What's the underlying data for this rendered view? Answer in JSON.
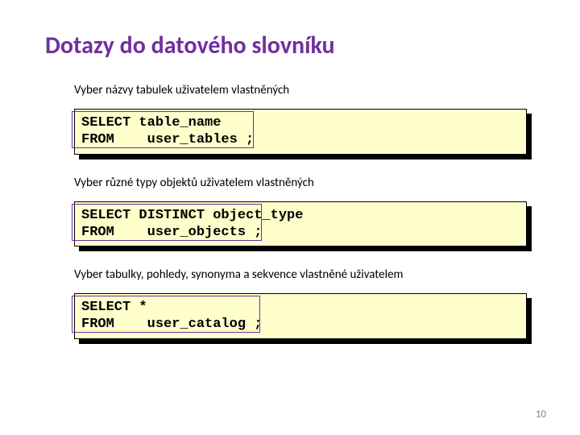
{
  "title": "Dotazy do datového slovníku",
  "sections": [
    {
      "desc": "Vyber názvy tabulek uživatelem vlastněných",
      "code": "SELECT table_name \nFROM    user_tables ;"
    },
    {
      "desc": "Vyber různé typy objektů uživatelem vlastněných",
      "code": "SELECT DISTINCT object_type \nFROM    user_objects ;"
    },
    {
      "desc": "Vyber tabulky, pohledy, synonyma a sekvence vlastněné uživatelem",
      "code": "SELECT * \nFROM    user_catalog ;"
    }
  ],
  "pageNumber": "10"
}
